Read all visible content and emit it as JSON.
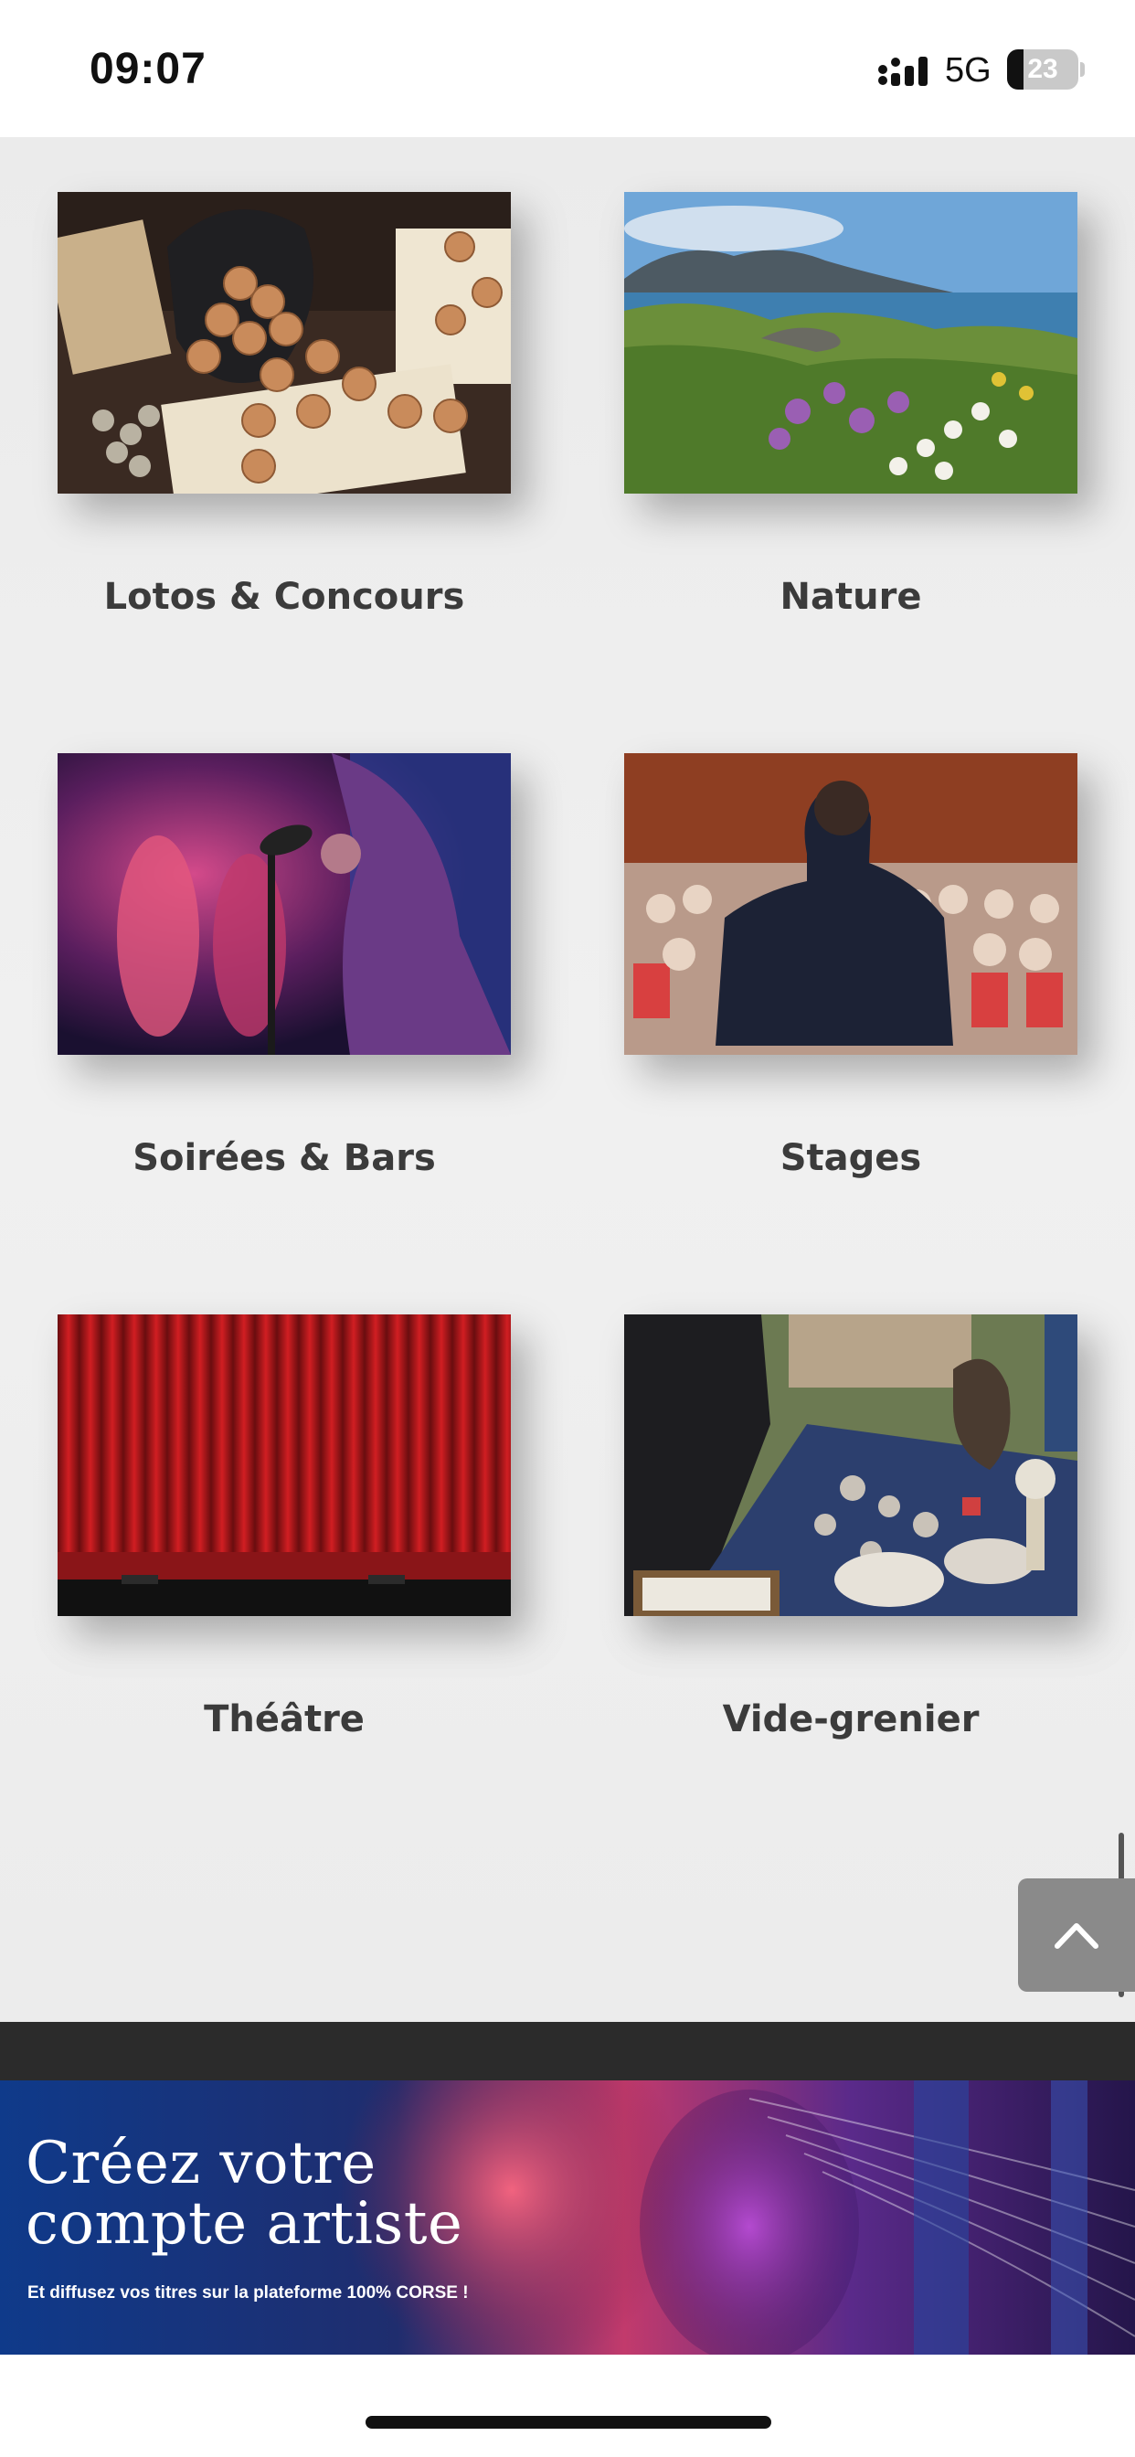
{
  "status_bar": {
    "time": "09:07",
    "network": "5G",
    "battery_level": "23",
    "battery_percent": 23
  },
  "categories": [
    {
      "label": "Lotos & Concours",
      "image": "lotto-tokens-photo"
    },
    {
      "label": "Nature",
      "image": "coastal-flowers-photo"
    },
    {
      "label": "Soirées & Bars",
      "image": "singer-microphone-photo"
    },
    {
      "label": "Stages",
      "image": "conference-speaker-photo"
    },
    {
      "label": "Théâtre",
      "image": "red-curtain-photo"
    },
    {
      "label": "Vide-grenier",
      "image": "flea-market-table-photo"
    }
  ],
  "scroll_top": {
    "icon": "chevron-up-icon"
  },
  "banner": {
    "title_line1": "Créez votre",
    "title_line2": "compte artiste",
    "subtitle": "Et diffusez vos titres sur la plateforme 100% CORSE !"
  },
  "colors": {
    "background": "#ececec",
    "label_text": "#3b3b3b",
    "footer_bar": "#2b2b2b",
    "scroll_button": "#8a8a8a"
  }
}
